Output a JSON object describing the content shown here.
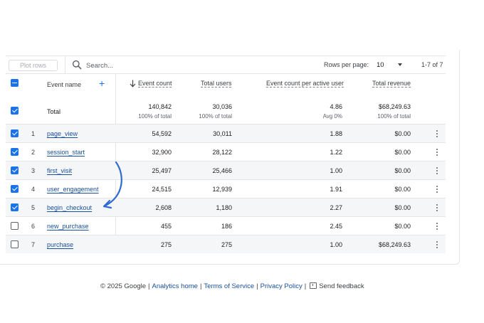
{
  "toolbar": {
    "plot_rows_label": "Plot rows",
    "search_placeholder": "Search...",
    "rows_per_page_label": "Rows per page:",
    "rows_per_page_value": "10",
    "pagination": "1-7 of 7"
  },
  "table": {
    "columns": {
      "event_name": "Event name",
      "event_count": "Event count",
      "total_users": "Total users",
      "per_user": "Event count per active user",
      "total_revenue": "Total revenue"
    },
    "totals": {
      "label": "Total",
      "event_count": "140,842",
      "event_count_sub": "100% of total",
      "total_users": "30,036",
      "total_users_sub": "100% of total",
      "per_user": "4.86",
      "per_user_sub": "Avg 0%",
      "total_revenue": "$68,249.63",
      "total_revenue_sub": "100% of total"
    },
    "rows": [
      {
        "idx": "1",
        "name": "page_view",
        "count": "54,592",
        "users": "30,011",
        "per_user": "1.88",
        "revenue": "$0.00",
        "checked": true
      },
      {
        "idx": "2",
        "name": "session_start",
        "count": "32,900",
        "users": "28,122",
        "per_user": "1.22",
        "revenue": "$0.00",
        "checked": true
      },
      {
        "idx": "3",
        "name": "first_visit",
        "count": "25,497",
        "users": "25,466",
        "per_user": "1.00",
        "revenue": "$0.00",
        "checked": true
      },
      {
        "idx": "4",
        "name": "user_engagement",
        "count": "24,515",
        "users": "12,939",
        "per_user": "1.91",
        "revenue": "$0.00",
        "checked": true
      },
      {
        "idx": "5",
        "name": "begin_checkout",
        "count": "2,608",
        "users": "1,180",
        "per_user": "2.27",
        "revenue": "$0.00",
        "checked": true
      },
      {
        "idx": "6",
        "name": "new_purchase",
        "count": "455",
        "users": "186",
        "per_user": "2.45",
        "revenue": "$0.00",
        "checked": false
      },
      {
        "idx": "7",
        "name": "purchase",
        "count": "275",
        "users": "275",
        "per_user": "1.00",
        "revenue": "$68,249.63",
        "checked": false
      }
    ]
  },
  "footer": {
    "copyright": "© 2025 Google",
    "analytics_home": "Analytics home",
    "terms": "Terms of Service",
    "privacy": "Privacy Policy",
    "feedback": "Send feedback"
  },
  "colors": {
    "accent": "#1a73e8",
    "link": "#1a4f9c",
    "annotation_arrow": "#2f6bd1"
  }
}
